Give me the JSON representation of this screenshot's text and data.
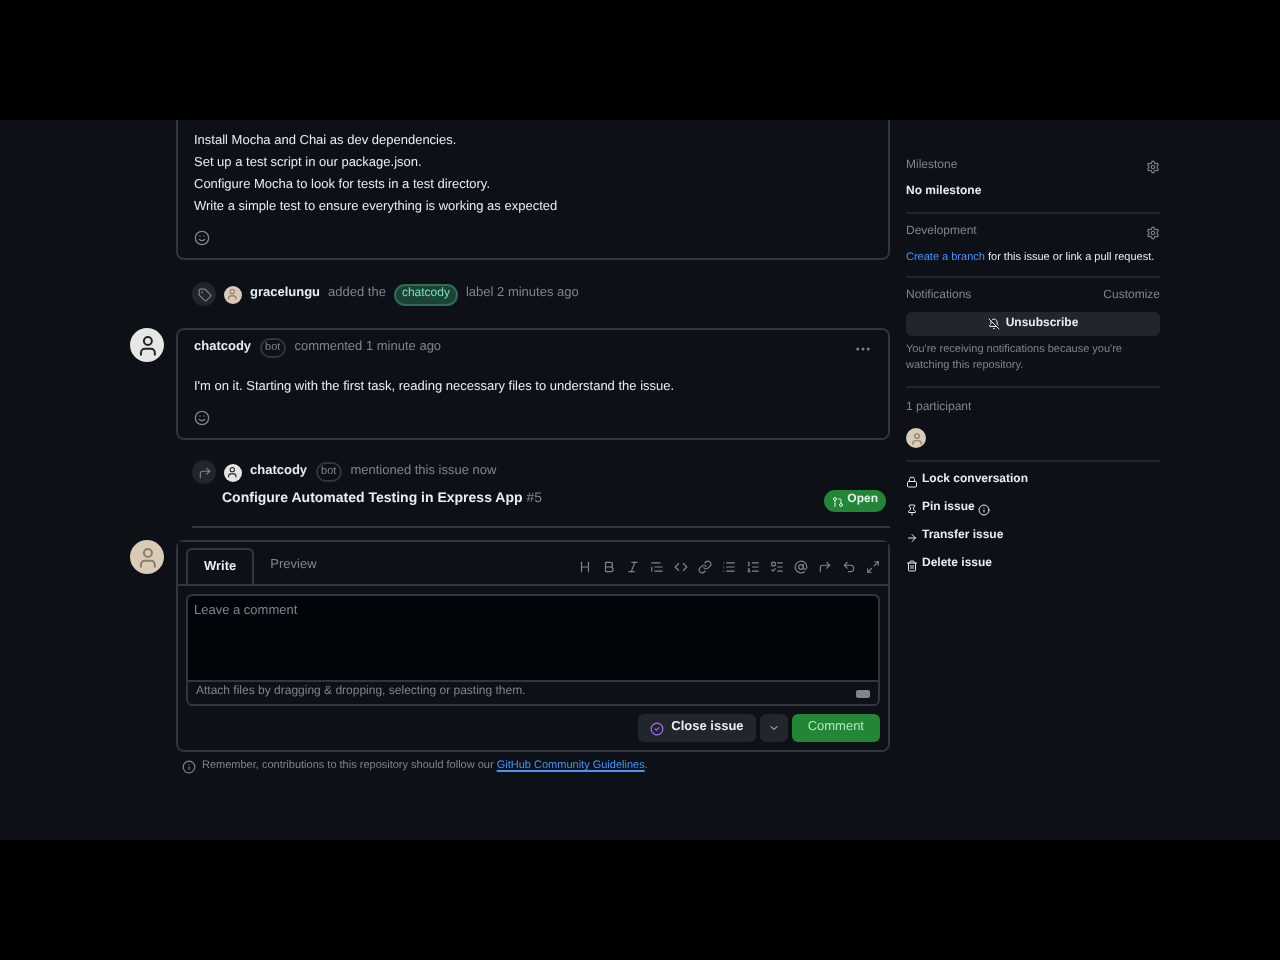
{
  "first_comment": {
    "lines": [
      "Install Mocha and Chai as dev dependencies.",
      "Set up a test script in our package.json.",
      "Configure Mocha to look for tests in a test directory.",
      "Write a simple test to ensure everything is working as expected"
    ]
  },
  "label_event": {
    "user": "gracelungu",
    "action": "added the",
    "label": "chatcody",
    "suffix": "label 2 minutes ago"
  },
  "comment": {
    "author": "chatcody",
    "badge": "bot",
    "meta": "commented 1 minute ago",
    "body": "I'm on it. Starting with the first task, reading necessary files to understand the issue."
  },
  "mention_event": {
    "user": "chatcody",
    "badge": "bot",
    "action": "mentioned this issue now",
    "title": "Configure Automated Testing in Express App",
    "number": "#5",
    "status": "Open"
  },
  "composer": {
    "tabs": [
      {
        "label": "Write",
        "selected": true
      },
      {
        "label": "Preview",
        "selected": false
      }
    ],
    "placeholder": "Leave a comment",
    "attach_hint": "Attach files by dragging & dropping, selecting or pasting them.",
    "close_button": "Close issue",
    "comment_button": "Comment"
  },
  "notice": {
    "text": "Remember, contributions to this repository should follow our",
    "link": "GitHub Community Guidelines",
    "end": "."
  },
  "sidebar": {
    "milestone": {
      "heading": "Milestone",
      "value": "No milestone"
    },
    "development": {
      "heading": "Development",
      "link": "Create a branch",
      "text": "for this issue or link a pull request."
    },
    "notifications": {
      "heading": "Notifications",
      "customize": "Customize",
      "button": "Unsubscribe",
      "note": "You're receiving notifications because you're watching this repository."
    },
    "participants": {
      "heading": "1 participant"
    },
    "actions": [
      {
        "kind": "lock",
        "label": "Lock conversation"
      },
      {
        "kind": "pin",
        "label": "Pin issue"
      },
      {
        "kind": "transfer",
        "label": "Transfer issue"
      },
      {
        "kind": "delete",
        "label": "Delete issue"
      }
    ]
  }
}
